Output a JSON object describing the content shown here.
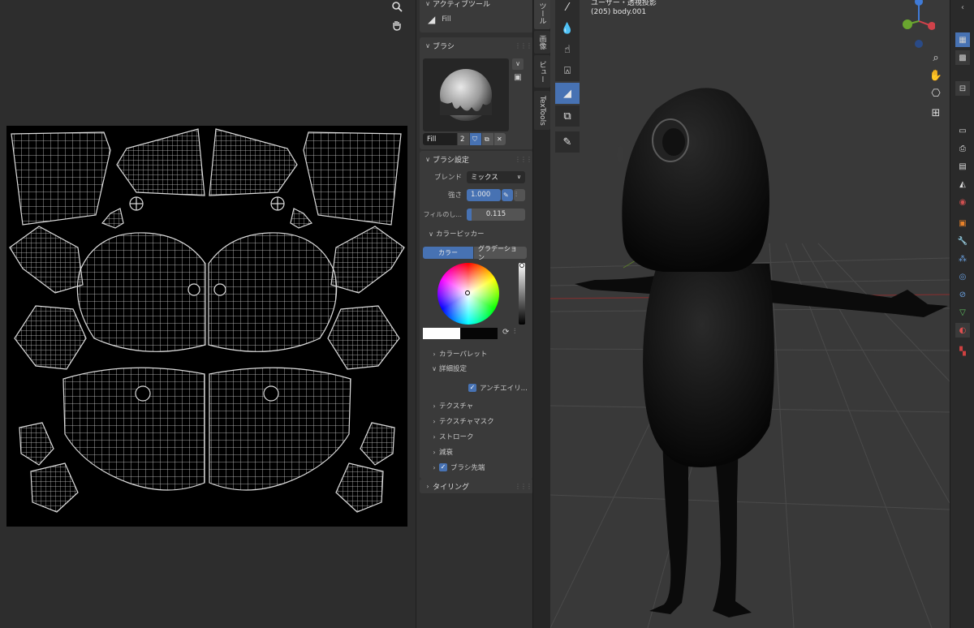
{
  "image_editor": {
    "zoom_icon": "zoom-icon",
    "pan_icon": "hand-icon"
  },
  "sidebar": {
    "active_tool": {
      "header": "アクティブツール",
      "name": "Fill"
    },
    "brush": {
      "header": "ブラシ",
      "name": "Fill",
      "users": "2"
    },
    "brush_settings": {
      "header": "ブラシ設定",
      "blend_label": "ブレンド",
      "blend_value": "ミックス",
      "strength_label": "強さ",
      "strength_value": "1.000",
      "fill_label": "フィルのし...",
      "fill_value": "0.115"
    },
    "color_picker": {
      "header": "カラーピッカー",
      "tab_color": "カラー",
      "tab_gradient": "グラデーション"
    },
    "color_palette": "カラーパレット",
    "advanced": {
      "header": "詳細設定",
      "antialias": "アンチエイリ..."
    },
    "texture": "テクスチャ",
    "texture_mask": "テクスチャマスク",
    "stroke": "ストローク",
    "falloff": "減衰",
    "cursor": "ブラシ先端",
    "tiling": "タイリング"
  },
  "tabs": {
    "tool": "ツール",
    "image": "画像",
    "view": "ビュー",
    "textools": "TexTools"
  },
  "viewport": {
    "view_name": "ユーザー・透視投影",
    "object_name": "(205) body.001"
  },
  "colors": {
    "accent": "#4772b3",
    "panel": "#3a3a3a",
    "background": "#2b2b2b"
  }
}
